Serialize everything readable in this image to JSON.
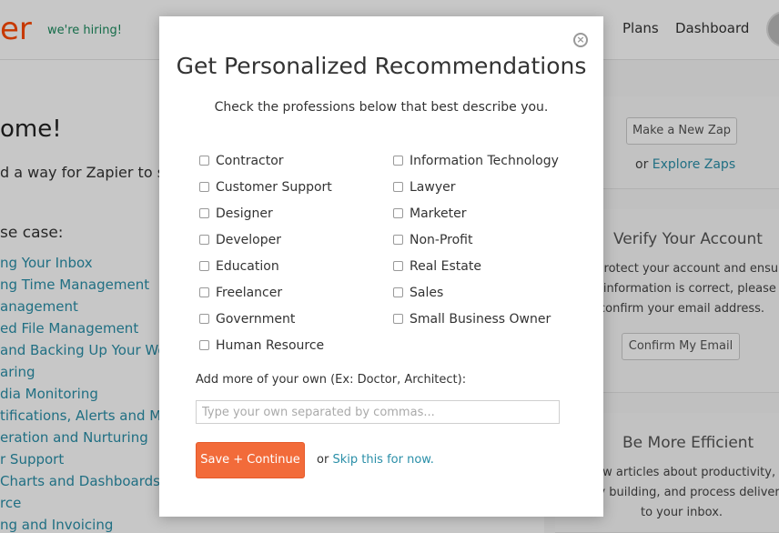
{
  "header": {
    "logo_text": "er",
    "hiring": "we're hiring!",
    "nav": [
      "Plans",
      "Dashboard"
    ]
  },
  "background": {
    "welcome": "ome!",
    "intro": "d a way for Zapier to save",
    "usecase_label": "se case:",
    "use_cases": [
      "ng Your Inbox",
      "ng Time Management",
      "anagement",
      "ed File Management",
      " and Backing Up Your Work",
      "aring",
      "dia Monitoring",
      "tifications, Alerts and Moni",
      "eration and Nurturing",
      "r Support",
      "Charts and Dashboards",
      "rce",
      "ng and Invoicing"
    ]
  },
  "sidebar": {
    "make_zap": "Make a New Zap",
    "or": "or",
    "explore": "Explore Zaps",
    "verify_title": "Verify Your Account",
    "verify_lines": [
      "p protect your account and ensu",
      "ur information is correct, please",
      "confirm your email address."
    ],
    "confirm_btn": "Confirm My Email",
    "efficient_title": "Be More Efficient",
    "efficient_lines": [
      "new articles about productivity,",
      "any building, and process deliver",
      "to your inbox."
    ]
  },
  "modal": {
    "close_glyph": "×",
    "title": "Get Personalized Recommendations",
    "subtitle": "Check the professions below that best describe you.",
    "professions_left": [
      "Contractor",
      "Customer Support",
      "Designer",
      "Developer",
      "Education",
      "Freelancer",
      "Government",
      "Human Resource"
    ],
    "professions_right": [
      "Information Technology",
      "Lawyer",
      "Marketer",
      "Non-Profit",
      "Real Estate",
      "Sales",
      "Small Business Owner"
    ],
    "add_label": "Add more of your own (Ex: Doctor, Architect):",
    "input_placeholder": "Type your own separated by commas...",
    "input_value": "",
    "save_label": "Save + Continue",
    "or": "or",
    "skip_label": "Skip this for now."
  }
}
